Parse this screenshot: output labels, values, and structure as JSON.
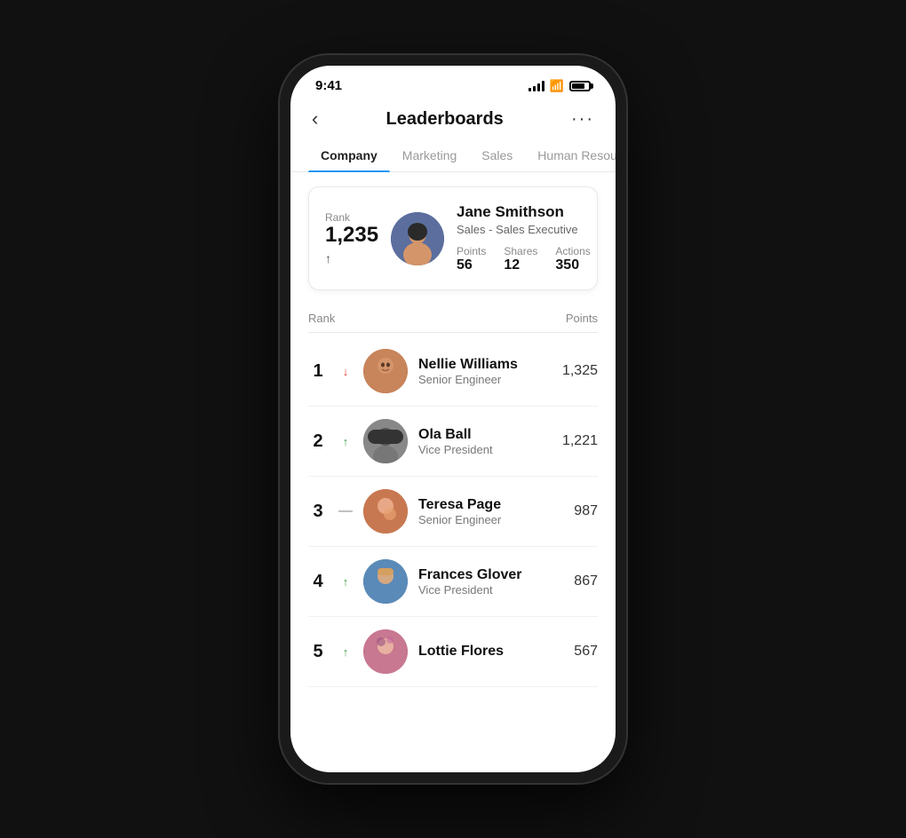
{
  "statusBar": {
    "time": "9:41"
  },
  "header": {
    "title": "Leaderboards",
    "backLabel": "‹",
    "moreLabel": "···"
  },
  "tabs": [
    {
      "id": "company",
      "label": "Company",
      "active": true
    },
    {
      "id": "marketing",
      "label": "Marketing",
      "active": false
    },
    {
      "id": "sales",
      "label": "Sales",
      "active": false
    },
    {
      "id": "hr",
      "label": "Human Resources",
      "active": false
    }
  ],
  "currentUser": {
    "rankLabel": "Rank",
    "rank": "1,235",
    "name": "Jane Smithson",
    "role": "Sales - Sales Executive",
    "pointsLabel": "Points",
    "points": "56",
    "sharesLabel": "Shares",
    "shares": "12",
    "actionsLabel": "Actions",
    "actions": "350"
  },
  "listHeaders": {
    "rank": "Rank",
    "points": "Points"
  },
  "leaderboard": [
    {
      "rank": "1",
      "trend": "↓",
      "trendType": "down",
      "name": "Nellie Williams",
      "role": "Senior Engineer",
      "points": "1,325",
      "avatarColor": "nellie"
    },
    {
      "rank": "2",
      "trend": "↑",
      "trendType": "up",
      "name": "Ola Ball",
      "role": "Vice President",
      "points": "1,221",
      "avatarColor": "ola"
    },
    {
      "rank": "3",
      "trend": "—",
      "trendType": "neutral",
      "name": "Teresa Page",
      "role": "Senior Engineer",
      "points": "987",
      "avatarColor": "teresa"
    },
    {
      "rank": "4",
      "trend": "↑",
      "trendType": "up",
      "name": "Frances Glover",
      "role": "Vice President",
      "points": "867",
      "avatarColor": "frances"
    },
    {
      "rank": "5",
      "trend": "↑",
      "trendType": "up",
      "name": "Lottie Flores",
      "role": "",
      "points": "567",
      "avatarColor": "lottie"
    }
  ]
}
